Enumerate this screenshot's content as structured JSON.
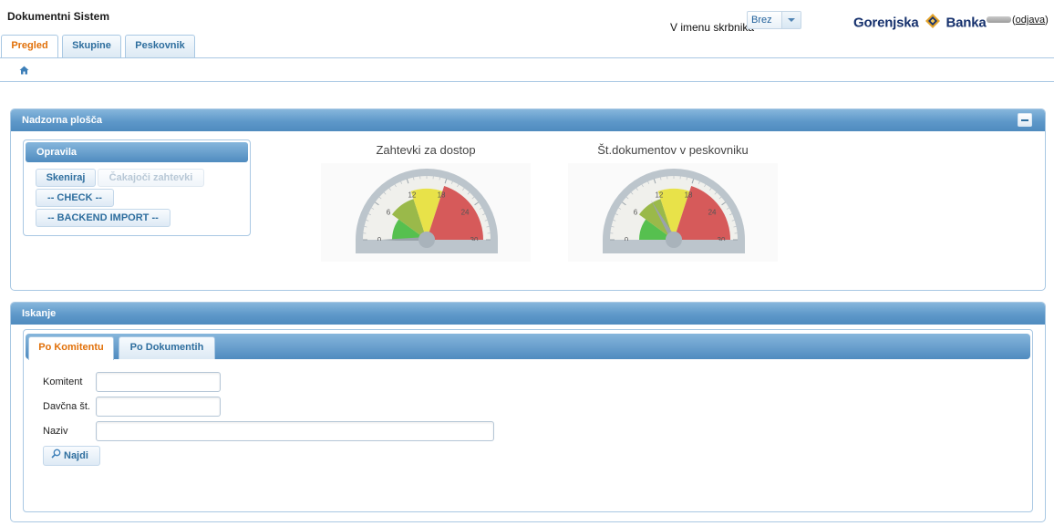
{
  "header": {
    "app_title": "Dokumentni Sistem",
    "skrbnik_label": "V imenu skrbnika",
    "skrbnik_value": "Brez",
    "brand_left": "Gorenjska",
    "brand_right": "Banka",
    "logout_label": "odjava"
  },
  "top_tabs": [
    {
      "label": "Pregled",
      "active": true
    },
    {
      "label": "Skupine",
      "active": false
    },
    {
      "label": "Peskovnik",
      "active": false
    }
  ],
  "dashboard": {
    "title": "Nadzorna plošča",
    "tasks": {
      "title": "Opravila",
      "buttons": [
        {
          "label": "Skeniraj",
          "enabled": true
        },
        {
          "label": "Čakajoči zahtevki",
          "enabled": false
        },
        {
          "label": "-- CHECK --",
          "enabled": true
        },
        {
          "label": "-- BACKEND IMPORT --",
          "enabled": true
        }
      ]
    },
    "gauges": [
      {
        "title": "Zahtevki za dostop",
        "ticks": [
          "0",
          "6",
          "12",
          "18",
          "24",
          "30"
        ],
        "min": 0,
        "max": 30,
        "value": 0
      },
      {
        "title": "Št.dokumentov v peskovniku",
        "ticks": [
          "0",
          "6",
          "12",
          "18",
          "24",
          "30"
        ],
        "min": 0,
        "max": 30,
        "value": 10
      }
    ]
  },
  "search": {
    "title": "Iskanje",
    "tabs": [
      {
        "label": "Po Komitentu",
        "active": true
      },
      {
        "label": "Po Dokumentih",
        "active": false
      }
    ],
    "fields": [
      {
        "label": "Komitent",
        "value": ""
      },
      {
        "label": "Davčna št.",
        "value": ""
      },
      {
        "label": "Naziv",
        "value": ""
      }
    ],
    "find_label": "Najdi"
  },
  "colors": {
    "accent": "#e17009",
    "header_blue": "#4f8bbf",
    "link_blue": "#2e6e9e",
    "gauge_green": "#56c04f",
    "gauge_olive": "#9ab94a",
    "gauge_yellow": "#e8e249",
    "gauge_red": "#d65a5a"
  },
  "icons": {
    "home": "home-icon",
    "search": "search-icon",
    "collapse": "minus-icon",
    "dropdown": "chevron-down-icon"
  }
}
